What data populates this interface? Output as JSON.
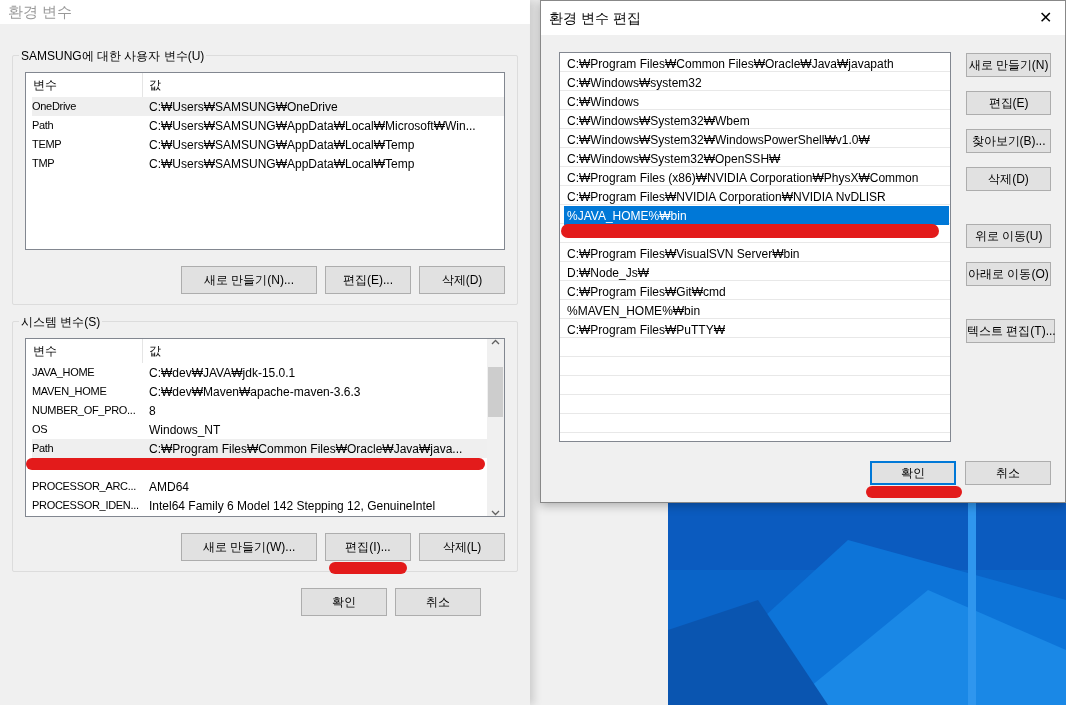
{
  "main_window": {
    "title": "환경 변수",
    "user_group": {
      "title": "SAMSUNG에 대한 사용자 변수(U)",
      "columns": [
        "변수",
        "값"
      ],
      "rows": [
        {
          "kind": "row",
          "name": "OneDrive",
          "value": "C:₩Users₩SAMSUNG₩OneDrive",
          "selected": true
        },
        {
          "kind": "row",
          "name": "Path",
          "value": "C:₩Users₩SAMSUNG₩AppData₩Local₩Microsoft₩Win...",
          "selected": false
        },
        {
          "kind": "row",
          "name": "TEMP",
          "value": "C:₩Users₩SAMSUNG₩AppData₩Local₩Temp",
          "selected": false
        },
        {
          "kind": "row",
          "name": "TMP",
          "value": "C:₩Users₩SAMSUNG₩AppData₩Local₩Temp",
          "selected": false
        }
      ],
      "buttons": [
        {
          "label": "새로 만들기(N)...",
          "marked": false
        },
        {
          "label": "편집(E)...",
          "marked": false
        },
        {
          "label": "삭제(D)",
          "marked": false
        }
      ]
    },
    "system_group": {
      "title": "시스템 변수(S)",
      "columns": [
        "변수",
        "값"
      ],
      "rows": [
        {
          "kind": "row",
          "name": "JAVA_HOME",
          "value": "C:₩dev₩JAVA₩jdk-15.0.1",
          "selected": false
        },
        {
          "kind": "row",
          "name": "MAVEN_HOME",
          "value": "C:₩dev₩Maven₩apache-maven-3.6.3",
          "selected": false
        },
        {
          "kind": "row",
          "name": "NUMBER_OF_PRO...",
          "value": "8",
          "selected": false
        },
        {
          "kind": "row",
          "name": "OS",
          "value": "Windows_NT",
          "selected": false
        },
        {
          "kind": "row",
          "name": "Path",
          "value": "C:₩Program Files₩Common Files₩Oracle₩Java₩java...",
          "selected": true
        },
        {
          "kind": "covered"
        },
        {
          "kind": "row",
          "name": "PROCESSOR_ARC...",
          "value": "AMD64",
          "selected": false
        },
        {
          "kind": "row",
          "name": "PROCESSOR_IDEN...",
          "value": "Intel64 Family 6 Model 142 Stepping 12, GenuineIntel",
          "selected": false
        }
      ],
      "buttons": [
        {
          "label": "새로 만들기(W)...",
          "marked": false
        },
        {
          "label": "편집(I)...",
          "marked": true
        },
        {
          "label": "삭제(L)",
          "marked": false
        }
      ]
    },
    "buttons": [
      {
        "label": "확인"
      },
      {
        "label": "취소"
      }
    ]
  },
  "edit_window": {
    "title": "환경 변수 편집",
    "close": "✕",
    "entries": [
      {
        "kind": "entry",
        "text": "C:₩Program Files₩Common Files₩Oracle₩Java₩javapath",
        "selected": false
      },
      {
        "kind": "entry",
        "text": "C:₩Windows₩system32",
        "selected": false
      },
      {
        "kind": "entry",
        "text": "C:₩Windows",
        "selected": false
      },
      {
        "kind": "entry",
        "text": "C:₩Windows₩System32₩Wbem",
        "selected": false
      },
      {
        "kind": "entry",
        "text": "C:₩Windows₩System32₩WindowsPowerShell₩v1.0₩",
        "selected": false
      },
      {
        "kind": "entry",
        "text": "C:₩Windows₩System32₩OpenSSH₩",
        "selected": false
      },
      {
        "kind": "entry",
        "text": "C:₩Program Files (x86)₩NVIDIA Corporation₩PhysX₩Common",
        "selected": false
      },
      {
        "kind": "entry",
        "text": "C:₩Program Files₩NVIDIA Corporation₩NVIDIA NvDLISR",
        "selected": false
      },
      {
        "kind": "entry",
        "text": "%JAVA_HOME%₩bin",
        "selected": true
      },
      {
        "kind": "covered"
      },
      {
        "kind": "entry",
        "text": "C:₩Program Files₩VisualSVN Server₩bin",
        "selected": false
      },
      {
        "kind": "entry",
        "text": "D:₩Node_Js₩",
        "selected": false
      },
      {
        "kind": "entry",
        "text": "C:₩Program Files₩Git₩cmd",
        "selected": false
      },
      {
        "kind": "entry",
        "text": "%MAVEN_HOME%₩bin",
        "selected": false
      },
      {
        "kind": "entry",
        "text": "C:₩Program Files₩PuTTY₩",
        "selected": false
      }
    ],
    "side_buttons": [
      "새로 만들기(N)",
      "편집(E)",
      "찾아보기(B)...",
      "삭제(D)",
      "위로 이동(U)",
      "아래로 이동(O)",
      "텍스트 편집(T)..."
    ],
    "footer_buttons": [
      {
        "label": "확인",
        "default": true,
        "marked": true
      },
      {
        "label": "취소",
        "default": false,
        "marked": false
      }
    ]
  }
}
